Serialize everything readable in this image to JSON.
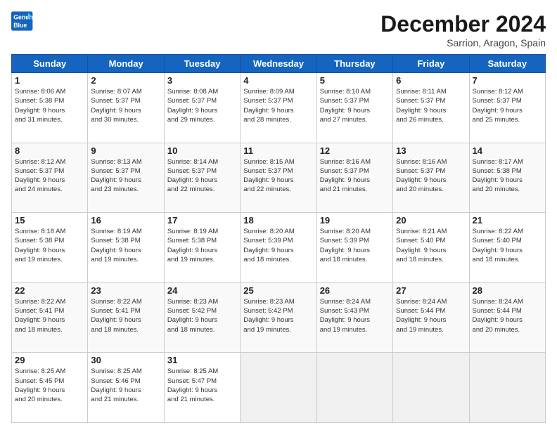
{
  "header": {
    "logo_line1": "General",
    "logo_line2": "Blue",
    "title": "December 2024",
    "subtitle": "Sarrion, Aragon, Spain"
  },
  "columns": [
    "Sunday",
    "Monday",
    "Tuesday",
    "Wednesday",
    "Thursday",
    "Friday",
    "Saturday"
  ],
  "weeks": [
    [
      {
        "day": "1",
        "info": "Sunrise: 8:06 AM\nSunset: 5:38 PM\nDaylight: 9 hours\nand 31 minutes."
      },
      {
        "day": "2",
        "info": "Sunrise: 8:07 AM\nSunset: 5:37 PM\nDaylight: 9 hours\nand 30 minutes."
      },
      {
        "day": "3",
        "info": "Sunrise: 8:08 AM\nSunset: 5:37 PM\nDaylight: 9 hours\nand 29 minutes."
      },
      {
        "day": "4",
        "info": "Sunrise: 8:09 AM\nSunset: 5:37 PM\nDaylight: 9 hours\nand 28 minutes."
      },
      {
        "day": "5",
        "info": "Sunrise: 8:10 AM\nSunset: 5:37 PM\nDaylight: 9 hours\nand 27 minutes."
      },
      {
        "day": "6",
        "info": "Sunrise: 8:11 AM\nSunset: 5:37 PM\nDaylight: 9 hours\nand 26 minutes."
      },
      {
        "day": "7",
        "info": "Sunrise: 8:12 AM\nSunset: 5:37 PM\nDaylight: 9 hours\nand 25 minutes."
      }
    ],
    [
      {
        "day": "8",
        "info": "Sunrise: 8:12 AM\nSunset: 5:37 PM\nDaylight: 9 hours\nand 24 minutes."
      },
      {
        "day": "9",
        "info": "Sunrise: 8:13 AM\nSunset: 5:37 PM\nDaylight: 9 hours\nand 23 minutes."
      },
      {
        "day": "10",
        "info": "Sunrise: 8:14 AM\nSunset: 5:37 PM\nDaylight: 9 hours\nand 22 minutes."
      },
      {
        "day": "11",
        "info": "Sunrise: 8:15 AM\nSunset: 5:37 PM\nDaylight: 9 hours\nand 22 minutes."
      },
      {
        "day": "12",
        "info": "Sunrise: 8:16 AM\nSunset: 5:37 PM\nDaylight: 9 hours\nand 21 minutes."
      },
      {
        "day": "13",
        "info": "Sunrise: 8:16 AM\nSunset: 5:37 PM\nDaylight: 9 hours\nand 20 minutes."
      },
      {
        "day": "14",
        "info": "Sunrise: 8:17 AM\nSunset: 5:38 PM\nDaylight: 9 hours\nand 20 minutes."
      }
    ],
    [
      {
        "day": "15",
        "info": "Sunrise: 8:18 AM\nSunset: 5:38 PM\nDaylight: 9 hours\nand 19 minutes."
      },
      {
        "day": "16",
        "info": "Sunrise: 8:19 AM\nSunset: 5:38 PM\nDaylight: 9 hours\nand 19 minutes."
      },
      {
        "day": "17",
        "info": "Sunrise: 8:19 AM\nSunset: 5:38 PM\nDaylight: 9 hours\nand 19 minutes."
      },
      {
        "day": "18",
        "info": "Sunrise: 8:20 AM\nSunset: 5:39 PM\nDaylight: 9 hours\nand 18 minutes."
      },
      {
        "day": "19",
        "info": "Sunrise: 8:20 AM\nSunset: 5:39 PM\nDaylight: 9 hours\nand 18 minutes."
      },
      {
        "day": "20",
        "info": "Sunrise: 8:21 AM\nSunset: 5:40 PM\nDaylight: 9 hours\nand 18 minutes."
      },
      {
        "day": "21",
        "info": "Sunrise: 8:22 AM\nSunset: 5:40 PM\nDaylight: 9 hours\nand 18 minutes."
      }
    ],
    [
      {
        "day": "22",
        "info": "Sunrise: 8:22 AM\nSunset: 5:41 PM\nDaylight: 9 hours\nand 18 minutes."
      },
      {
        "day": "23",
        "info": "Sunrise: 8:22 AM\nSunset: 5:41 PM\nDaylight: 9 hours\nand 18 minutes."
      },
      {
        "day": "24",
        "info": "Sunrise: 8:23 AM\nSunset: 5:42 PM\nDaylight: 9 hours\nand 18 minutes."
      },
      {
        "day": "25",
        "info": "Sunrise: 8:23 AM\nSunset: 5:42 PM\nDaylight: 9 hours\nand 19 minutes."
      },
      {
        "day": "26",
        "info": "Sunrise: 8:24 AM\nSunset: 5:43 PM\nDaylight: 9 hours\nand 19 minutes."
      },
      {
        "day": "27",
        "info": "Sunrise: 8:24 AM\nSunset: 5:44 PM\nDaylight: 9 hours\nand 19 minutes."
      },
      {
        "day": "28",
        "info": "Sunrise: 8:24 AM\nSunset: 5:44 PM\nDaylight: 9 hours\nand 20 minutes."
      }
    ],
    [
      {
        "day": "29",
        "info": "Sunrise: 8:25 AM\nSunset: 5:45 PM\nDaylight: 9 hours\nand 20 minutes."
      },
      {
        "day": "30",
        "info": "Sunrise: 8:25 AM\nSunset: 5:46 PM\nDaylight: 9 hours\nand 21 minutes."
      },
      {
        "day": "31",
        "info": "Sunrise: 8:25 AM\nSunset: 5:47 PM\nDaylight: 9 hours\nand 21 minutes."
      },
      {
        "day": "",
        "info": ""
      },
      {
        "day": "",
        "info": ""
      },
      {
        "day": "",
        "info": ""
      },
      {
        "day": "",
        "info": ""
      }
    ]
  ]
}
